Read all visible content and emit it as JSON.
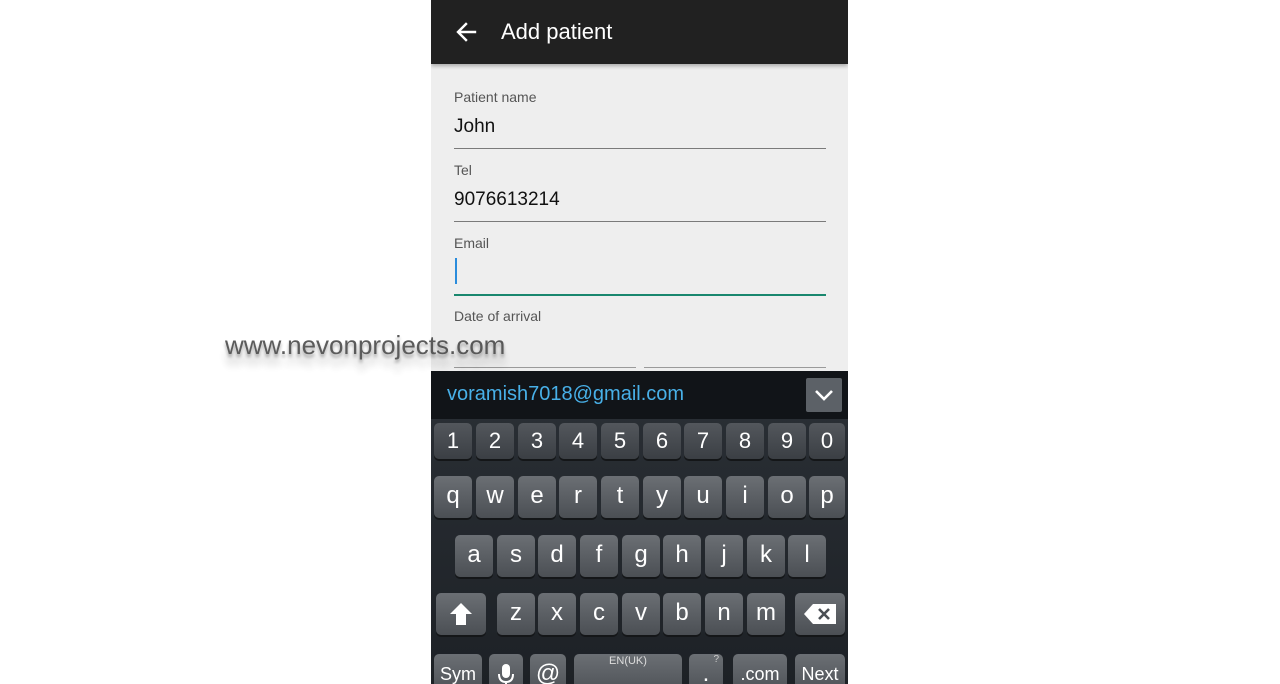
{
  "appbar": {
    "title": "Add patient",
    "back_icon": "arrow-back-icon"
  },
  "form": {
    "fields": [
      {
        "label": "Patient name",
        "value": "John"
      },
      {
        "label": "Tel",
        "value": "9076613214"
      },
      {
        "label": "Email",
        "value": ""
      },
      {
        "label": "Date of arrival"
      }
    ]
  },
  "keyboard": {
    "suggestion": "voramish7018@gmail.com",
    "collapse_icon": "chevron-down-icon",
    "number_row": [
      "1",
      "2",
      "3",
      "4",
      "5",
      "6",
      "7",
      "8",
      "9",
      "0"
    ],
    "row1": [
      "q",
      "w",
      "e",
      "r",
      "t",
      "y",
      "u",
      "i",
      "o",
      "p"
    ],
    "row2": [
      "a",
      "s",
      "d",
      "f",
      "g",
      "h",
      "j",
      "k",
      "l"
    ],
    "row3": [
      "z",
      "x",
      "c",
      "v",
      "b",
      "n",
      "m"
    ],
    "shift_icon": "shift-arrow-icon",
    "backspace_icon": "backspace-icon",
    "bottom": {
      "sym": "Sym",
      "mic_icon": "microphone-icon",
      "at": "@",
      "space_language": "EN(UK)",
      "period": ".",
      "period_hint": "?",
      "dotcom": ".com",
      "next": "Next"
    }
  },
  "watermark": "www.nevonprojects.com",
  "colors": {
    "appbar": "#212121",
    "active_underline": "#19876e",
    "caret": "#2a8cdc",
    "suggestion_text": "#48b0e8"
  }
}
